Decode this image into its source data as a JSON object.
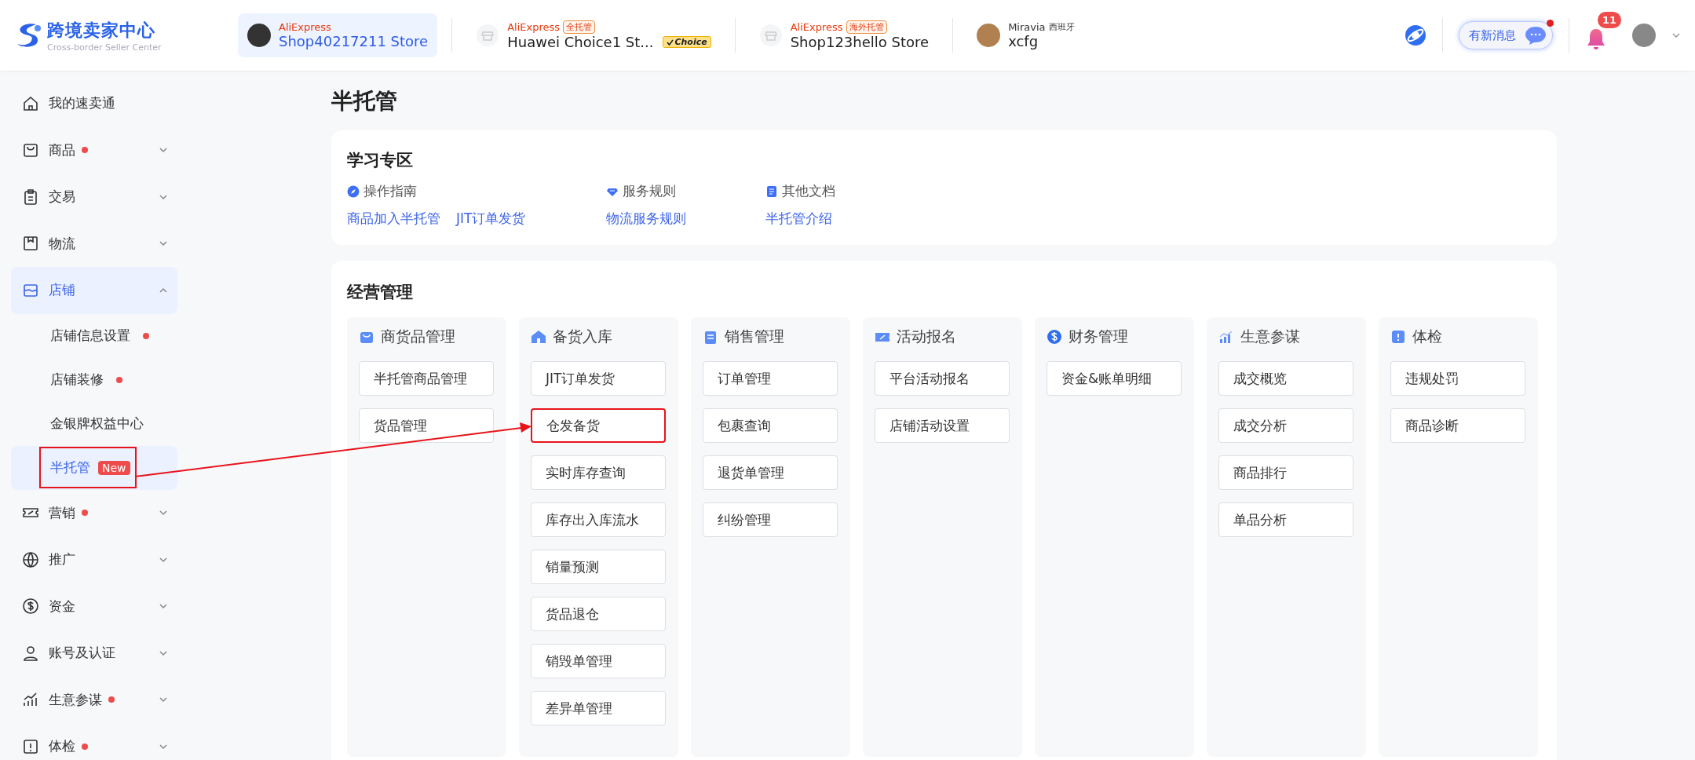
{
  "header": {
    "logo": {
      "title": "跨境卖家中心",
      "subtitle": "Cross-border Seller Center"
    },
    "stores": [
      {
        "kind": "aliexpress",
        "platform": "AliExpress",
        "name": "Shop40217211 Store",
        "selected": true
      },
      {
        "kind": "aliexpress",
        "platform": "AliExpress",
        "tag": "全托管",
        "name": "Huawei Choice1 St...",
        "choice": "Choice",
        "selected": false
      },
      {
        "kind": "aliexpress",
        "platform": "AliExpress",
        "tag": "海外托管",
        "name": "Shop123hello Store",
        "selected": false
      },
      {
        "kind": "miravia",
        "platform": "Miravia",
        "region": "西班牙",
        "name": "xcfg",
        "selected": false
      }
    ],
    "messages": {
      "label": "有新消息",
      "unread": true
    },
    "notifications": {
      "count": "11"
    }
  },
  "sidebar": {
    "items": [
      {
        "label": "我的速卖通",
        "dot": false,
        "expandable": false,
        "selected": false
      },
      {
        "label": "商品",
        "dot": true,
        "expandable": true,
        "expanded": false,
        "selected": false
      },
      {
        "label": "交易",
        "dot": false,
        "expandable": true,
        "expanded": false,
        "selected": false
      },
      {
        "label": "物流",
        "dot": false,
        "expandable": true,
        "expanded": false,
        "selected": false
      },
      {
        "label": "店铺",
        "dot": false,
        "expandable": true,
        "expanded": true,
        "selected": true,
        "children": [
          {
            "label": "店铺信息设置",
            "dot": true,
            "selected": false,
            "highlighted": false
          },
          {
            "label": "店铺装修",
            "dot": true,
            "selected": false,
            "highlighted": false
          },
          {
            "label": "金银牌权益中心",
            "dot": false,
            "selected": false,
            "highlighted": false
          },
          {
            "label": "半托管",
            "badge": "New",
            "dot": false,
            "selected": true,
            "highlighted": true
          }
        ]
      },
      {
        "label": "营销",
        "dot": true,
        "expandable": true,
        "expanded": false,
        "selected": false
      },
      {
        "label": "推广",
        "dot": false,
        "expandable": true,
        "expanded": false,
        "selected": false
      },
      {
        "label": "资金",
        "dot": false,
        "expandable": true,
        "expanded": false,
        "selected": false
      },
      {
        "label": "账号及认证",
        "dot": false,
        "expandable": true,
        "expanded": false,
        "selected": false
      },
      {
        "label": "生意参谋",
        "dot": true,
        "expandable": true,
        "expanded": false,
        "selected": false
      },
      {
        "label": "体检",
        "dot": true,
        "expandable": true,
        "expanded": false,
        "selected": false
      }
    ]
  },
  "page_title": "半托管",
  "study": {
    "title": "学习专区",
    "columns": [
      {
        "heading": "操作指南",
        "links": [
          "商品加入半托管",
          "JIT订单发货"
        ]
      },
      {
        "heading": "服务规则",
        "links": [
          "物流服务规则"
        ]
      },
      {
        "heading": "其他文档",
        "links": [
          "半托管介绍"
        ]
      }
    ]
  },
  "management": {
    "title": "经营管理",
    "groups": [
      {
        "title": "商货品管理",
        "buttons": [
          {
            "label": "半托管商品管理",
            "highlighted": false
          },
          {
            "label": "货品管理",
            "highlighted": false
          }
        ]
      },
      {
        "title": "备货入库",
        "buttons": [
          {
            "label": "JIT订单发货",
            "highlighted": false
          },
          {
            "label": "仓发备货",
            "highlighted": true
          },
          {
            "label": "实时库存查询",
            "highlighted": false
          },
          {
            "label": "库存出入库流水",
            "highlighted": false
          },
          {
            "label": "销量预测",
            "highlighted": false
          },
          {
            "label": "货品退仓",
            "highlighted": false
          },
          {
            "label": "销毁单管理",
            "highlighted": false
          },
          {
            "label": "差异单管理",
            "highlighted": false
          }
        ]
      },
      {
        "title": "销售管理",
        "buttons": [
          {
            "label": "订单管理",
            "highlighted": false
          },
          {
            "label": "包裹查询",
            "highlighted": false
          },
          {
            "label": "退货单管理",
            "highlighted": false
          },
          {
            "label": "纠纷管理",
            "highlighted": false
          }
        ]
      },
      {
        "title": "活动报名",
        "buttons": [
          {
            "label": "平台活动报名",
            "highlighted": false
          },
          {
            "label": "店铺活动设置",
            "highlighted": false
          }
        ]
      },
      {
        "title": "财务管理",
        "buttons": [
          {
            "label": "资金&账单明细",
            "highlighted": false
          }
        ]
      },
      {
        "title": "生意参谋",
        "buttons": [
          {
            "label": "成交概览",
            "highlighted": false
          },
          {
            "label": "成交分析",
            "highlighted": false
          },
          {
            "label": "商品排行",
            "highlighted": false
          },
          {
            "label": "单品分析",
            "highlighted": false
          }
        ]
      },
      {
        "title": "体检",
        "buttons": [
          {
            "label": "违规处罚",
            "highlighted": false
          },
          {
            "label": "商品诊断",
            "highlighted": false
          }
        ]
      }
    ]
  }
}
